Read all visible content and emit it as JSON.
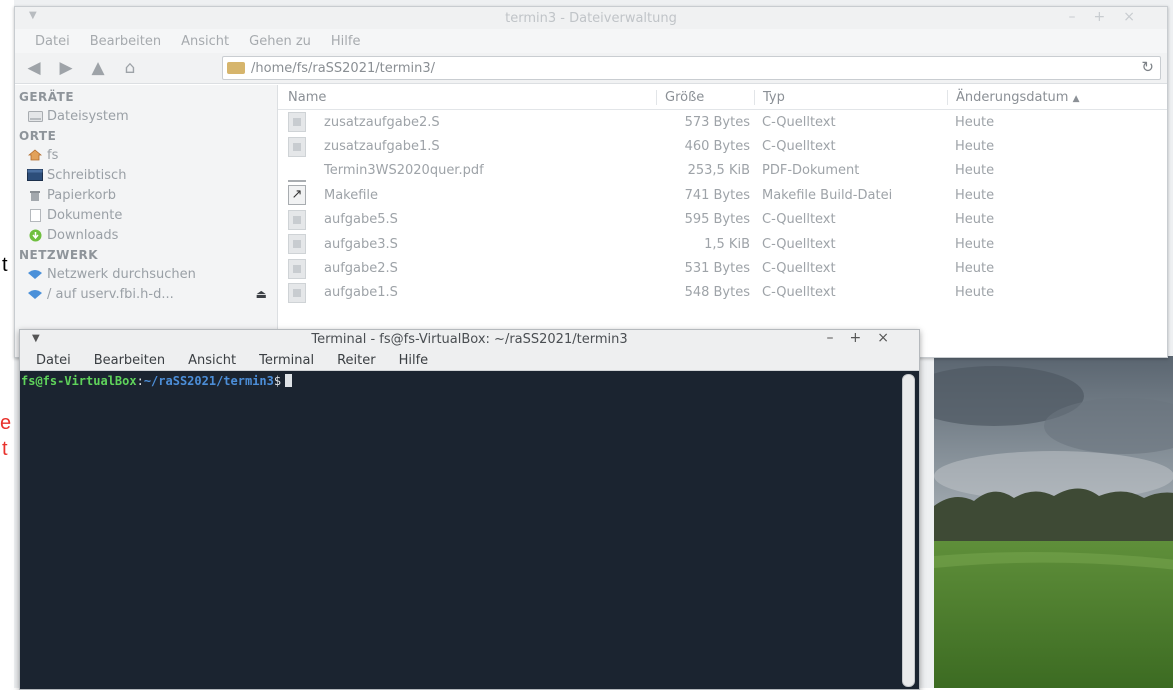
{
  "slide_fragments": {
    "t1": "t",
    "e": "e",
    "t2": "t"
  },
  "file_manager": {
    "title": "termin3 - Dateiverwaltung",
    "menu": [
      "Datei",
      "Bearbeiten",
      "Ansicht",
      "Gehen zu",
      "Hilfe"
    ],
    "path": "/home/fs/raSS2021/termin3/",
    "sidebar": {
      "devices_header": "GERÄTE",
      "devices": [
        {
          "label": "Dateisystem",
          "icon": "drive-icon"
        }
      ],
      "places_header": "ORTE",
      "places": [
        {
          "label": "fs",
          "icon": "home-icon"
        },
        {
          "label": "Schreibtisch",
          "icon": "desktop-icon"
        },
        {
          "label": "Papierkorb",
          "icon": "trash-icon"
        },
        {
          "label": "Dokumente",
          "icon": "documents-icon"
        },
        {
          "label": "Downloads",
          "icon": "download-icon"
        }
      ],
      "network_header": "NETZWERK",
      "network": [
        {
          "label": "Netzwerk durchsuchen",
          "icon": "wifi-icon"
        },
        {
          "label": "/ auf userv.fbi.h-d...",
          "icon": "wifi-icon"
        }
      ]
    },
    "columns": {
      "name": "Name",
      "size": "Größe",
      "type": "Typ",
      "date": "Änderungsdatum"
    },
    "files": [
      {
        "name": "zusatzaufgabe2.S",
        "size": "573 Bytes",
        "type": "C-Quelltext",
        "date": "Heute",
        "icon": "source-file-icon"
      },
      {
        "name": "zusatzaufgabe1.S",
        "size": "460 Bytes",
        "type": "C-Quelltext",
        "date": "Heute",
        "icon": "source-file-icon"
      },
      {
        "name": "Termin3WS2020quer.pdf",
        "size": "253,5 KiB",
        "type": "PDF-Dokument",
        "date": "Heute",
        "icon": "pdf-file-icon"
      },
      {
        "name": "Makefile",
        "size": "741 Bytes",
        "type": "Makefile Build-Datei",
        "date": "Heute",
        "icon": "makefile-icon"
      },
      {
        "name": "aufgabe5.S",
        "size": "595 Bytes",
        "type": "C-Quelltext",
        "date": "Heute",
        "icon": "source-file-icon"
      },
      {
        "name": "aufgabe3.S",
        "size": "1,5 KiB",
        "type": "C-Quelltext",
        "date": "Heute",
        "icon": "source-file-icon"
      },
      {
        "name": "aufgabe2.S",
        "size": "531 Bytes",
        "type": "C-Quelltext",
        "date": "Heute",
        "icon": "source-file-icon"
      },
      {
        "name": "aufgabe1.S",
        "size": "548 Bytes",
        "type": "C-Quelltext",
        "date": "Heute",
        "icon": "source-file-icon"
      }
    ]
  },
  "terminal": {
    "title": "Terminal - fs@fs-VirtualBox: ~/raSS2021/termin3",
    "menu": [
      "Datei",
      "Bearbeiten",
      "Ansicht",
      "Terminal",
      "Reiter",
      "Hilfe"
    ],
    "prompt_user": "fs@fs-VirtualBox",
    "prompt_path": "~/raSS2021/termin3",
    "prompt_sign": "$"
  },
  "colors": {
    "terminal_bg": "#1b2430",
    "prompt_user": "#5fd35b",
    "prompt_path": "#4c8ed8",
    "slide_red": "#e8322c"
  }
}
